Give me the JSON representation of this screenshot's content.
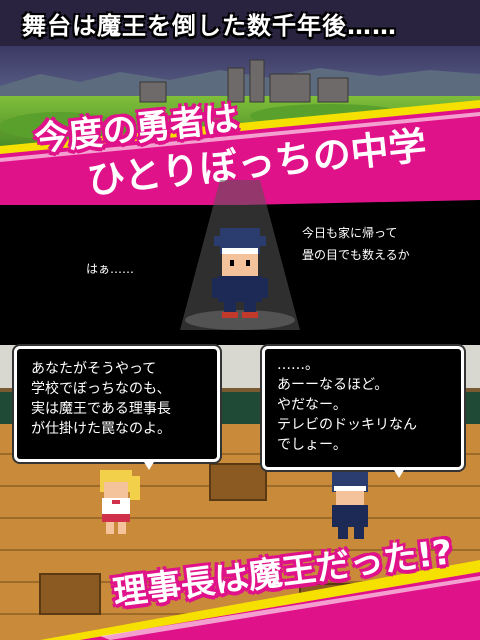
{
  "top_banner": {
    "text": "舞台は魔王を倒した数千年後……"
  },
  "slogan": {
    "line1": "今度の勇者は",
    "line2": "ひとりぼっちの中学生!?"
  },
  "speech": {
    "left": "はぁ……",
    "right": "今日も家に帰って\n畳の目でも数えるか"
  },
  "dialog_left": {
    "text": "あなたがそうやって\n学校でぼっちなのも、\n実は魔王である理事長\nが仕掛けた罠なのよ。"
  },
  "dialog_right": {
    "text": "……。\nあーーなるほど。\nやだなー。\nテレビのドッキリなん\nでしょー。"
  },
  "bottom_slogan": {
    "text": "理事長は魔王だった!?"
  },
  "colors": {
    "accent_pink": "#e0128a",
    "yellow": "#f5e000",
    "floor": "#c98a3a"
  }
}
